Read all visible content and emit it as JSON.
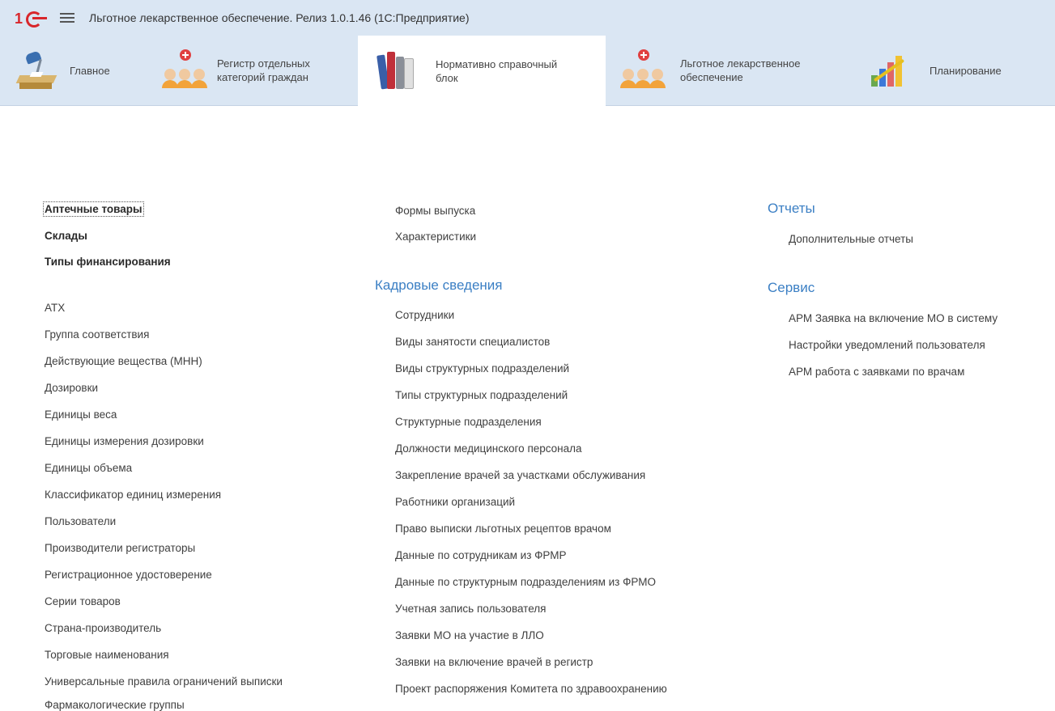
{
  "app": {
    "title": "Льготное лекарственное обеспечение. Релиз 1.0.1.46  (1С:Предприятие)",
    "logo": "1С"
  },
  "sections": [
    {
      "label": "Главное",
      "icon": "desk-icon",
      "active": false
    },
    {
      "label": "Регистр отдельных\nкатегорий граждан",
      "icon": "people-icon",
      "active": false
    },
    {
      "label": "Нормативно справочный\nблок",
      "icon": "books-icon",
      "active": true
    },
    {
      "label": "Льготное лекарственное\nобеспечение",
      "icon": "people-icon",
      "active": false
    },
    {
      "label": "Планирование",
      "icon": "chart-icon",
      "active": false
    }
  ],
  "col1": {
    "bold_items": [
      "Аптечные товары",
      "Склады",
      "Типы финансирования"
    ],
    "items": [
      "АТХ",
      "Группа соответствия",
      "Действующие вещества (МНН)",
      "Дозировки",
      "Единицы веса",
      "Единицы измерения дозировки",
      "Единицы объема",
      "Классификатор единиц измерения",
      "Пользователи",
      "Производители регистраторы",
      "Регистрационное удостоверение",
      "Серии товаров",
      "Страна-производитель",
      "Торговые наименования",
      "Универсальные правила ограничений выписки",
      "Фармакологические группы"
    ]
  },
  "col2": {
    "top_items": [
      "Формы выпуска",
      "Характеристики"
    ],
    "heading": "Кадровые сведения",
    "items": [
      "Сотрудники",
      "Виды занятости специалистов",
      "Виды структурных подразделений",
      "Типы структурных подразделений",
      "Структурные подразделения",
      "Должности медицинского персонала",
      "Закрепление врачей за участками обслуживания",
      "Работники организаций",
      "Право выписки льготных рецептов врачом",
      "Данные по сотрудникам из ФРМР",
      "Данные по структурным подразделениям из ФРМО",
      "Учетная запись пользователя",
      "Заявки МО на участие в ЛЛО",
      "Заявки на включение врачей в регистр",
      "Проект распоряжения Комитета по здравоохранению"
    ]
  },
  "col3": {
    "reports_heading": "Отчеты",
    "reports_items": [
      "Дополнительные отчеты"
    ],
    "service_heading": "Сервис",
    "service_items": [
      "АРМ Заявка на включение МО в систему",
      "Настройки уведомлений пользователя",
      "АРМ работа с заявками по врачам"
    ]
  },
  "colors": {
    "header_bg": "#dae6f3",
    "heading_blue": "#3b7fc4",
    "logo_red": "#d8262b"
  }
}
